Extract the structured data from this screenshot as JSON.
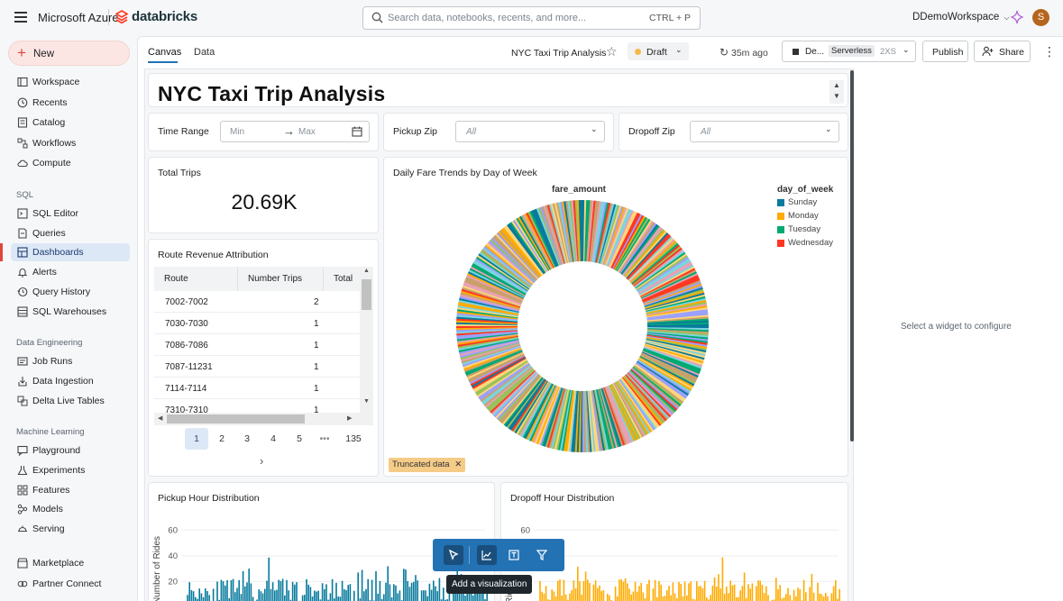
{
  "topbar": {
    "brand": "Microsoft Azure",
    "product": "databricks",
    "search_placeholder": "Search data, notebooks, recents, and more...",
    "search_shortcut": "CTRL + P",
    "workspace": "DDemoWorkspace",
    "avatar_initial": "S"
  },
  "sidebar": {
    "new_label": "New",
    "items_top": [
      {
        "label": "Workspace",
        "icon": "folder-icon"
      },
      {
        "label": "Recents",
        "icon": "clock-icon"
      },
      {
        "label": "Catalog",
        "icon": "catalog-icon"
      },
      {
        "label": "Workflows",
        "icon": "workflows-icon"
      },
      {
        "label": "Compute",
        "icon": "cloud-icon"
      }
    ],
    "sql_header": "SQL",
    "items_sql": [
      {
        "label": "SQL Editor",
        "icon": "sql-editor-icon"
      },
      {
        "label": "Queries",
        "icon": "queries-icon"
      },
      {
        "label": "Dashboards",
        "icon": "dashboard-icon"
      },
      {
        "label": "Alerts",
        "icon": "bell-icon"
      },
      {
        "label": "Query History",
        "icon": "history-icon"
      },
      {
        "label": "SQL Warehouses",
        "icon": "warehouse-icon"
      }
    ],
    "de_header": "Data Engineering",
    "items_de": [
      {
        "label": "Job Runs",
        "icon": "job-runs-icon"
      },
      {
        "label": "Data Ingestion",
        "icon": "ingestion-icon"
      },
      {
        "label": "Delta Live Tables",
        "icon": "delta-icon"
      }
    ],
    "ml_header": "Machine Learning",
    "items_ml": [
      {
        "label": "Playground",
        "icon": "playground-icon"
      },
      {
        "label": "Experiments",
        "icon": "flask-icon"
      },
      {
        "label": "Features",
        "icon": "features-icon"
      },
      {
        "label": "Models",
        "icon": "models-icon"
      },
      {
        "label": "Serving",
        "icon": "serving-icon"
      }
    ],
    "items_bottom": [
      {
        "label": "Marketplace",
        "icon": "marketplace-icon"
      },
      {
        "label": "Partner Connect",
        "icon": "partner-icon"
      }
    ]
  },
  "header": {
    "tabs": [
      "Canvas",
      "Data"
    ],
    "dashboard_name": "NYC Taxi Trip Analysis",
    "status": "Draft",
    "last_saved": "35m ago",
    "compute_name": "De...",
    "compute_type": "Serverless",
    "compute_size": "2XS",
    "publish_label": "Publish",
    "share_label": "Share"
  },
  "canvas": {
    "title": "NYC Taxi Trip Analysis",
    "filters": {
      "time_range_label": "Time Range",
      "min_placeholder": "Min",
      "max_placeholder": "Max",
      "pickup_zip_label": "Pickup Zip",
      "pickup_zip_value": "All",
      "dropoff_zip_label": "Dropoff Zip",
      "dropoff_zip_value": "All"
    },
    "total_trips": {
      "title": "Total Trips",
      "value": "20.69K"
    },
    "route_table": {
      "title": "Route Revenue Attribution",
      "columns": [
        "Route",
        "Number Trips",
        "Total"
      ],
      "rows": [
        [
          "7002-7002",
          "2"
        ],
        [
          "7030-7030",
          "1"
        ],
        [
          "7086-7086",
          "1"
        ],
        [
          "7087-11231",
          "1"
        ],
        [
          "7114-7114",
          "1"
        ],
        [
          "7310-7310",
          "1"
        ]
      ],
      "pages": [
        "1",
        "2",
        "3",
        "4",
        "5",
        "•••",
        "135"
      ],
      "current_page": "1"
    },
    "pie": {
      "title": "Daily Fare Trends by Day of Week",
      "measure": "fare_amount",
      "legend_title": "day_of_week",
      "legend": [
        {
          "label": "Sunday",
          "color": "#077a9d"
        },
        {
          "label": "Monday",
          "color": "#ffab00"
        },
        {
          "label": "Tuesday",
          "color": "#00a972"
        },
        {
          "label": "Wednesday",
          "color": "#ff3621"
        }
      ],
      "truncated_label": "Truncated data"
    },
    "pickup_hist": {
      "title": "Pickup Hour Distribution",
      "ylabel": "Number of Rides",
      "yticks": [
        "60",
        "40",
        "20"
      ],
      "color": "#077a9d"
    },
    "dropoff_hist": {
      "title": "Dropoff Hour Distribution",
      "ylabel": "Rides",
      "yticks": [
        "60",
        "40",
        "20"
      ],
      "color": "#ffab00"
    },
    "tooltip": "Add a visualization"
  },
  "right_panel": {
    "message": "Select a widget to configure"
  }
}
